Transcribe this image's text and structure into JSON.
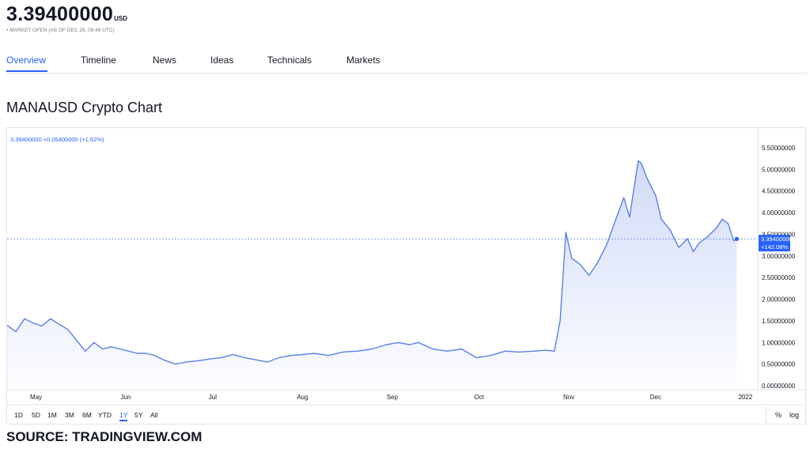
{
  "header": {
    "price": "3.39400000",
    "currency": "USD",
    "status_dot": "•",
    "status_text": "MARKET OPEN",
    "status_time": "(AS OF DEC 29, 09:48 UTC)"
  },
  "tabs": [
    "Overview",
    "Timeline",
    "News",
    "Ideas",
    "Technicals",
    "Markets"
  ],
  "active_tab": "Overview",
  "chart_title": "MANAUSD Crypto Chart",
  "chart_legend": "3.39400000 +0.05400000 (+1.62%)",
  "last_price_label": "3.39400000",
  "last_change_label": "+142.08%",
  "ranges": [
    "1D",
    "5D",
    "1M",
    "3M",
    "6M",
    "YTD",
    "1Y",
    "5Y",
    "All"
  ],
  "active_range": "1Y",
  "options": {
    "percent": "%",
    "log": "log"
  },
  "source": "SOURCE: TRADINGVIEW.COM",
  "colors": {
    "accent": "#2962ff",
    "line": "#5b7fe8",
    "status_green": "#26a69a"
  },
  "chart_data": {
    "type": "area",
    "title": "MANAUSD Crypto Chart",
    "xlabel": "",
    "ylabel": "",
    "ylim": [
      0,
      5.5
    ],
    "xlim": [
      "2021-04-21",
      "2022-01-05"
    ],
    "grid": false,
    "y_ticks": [
      "0.00000000",
      "0.50000000",
      "1.00000000",
      "1.50000000",
      "2.00000000",
      "2.50000000",
      "3.00000000",
      "3.50000000",
      "4.00000000",
      "4.50000000",
      "5.00000000",
      "5.50000000"
    ],
    "y_tick_values": [
      0,
      0.5,
      1,
      1.5,
      2,
      2.5,
      3,
      3.5,
      4,
      4.5,
      5,
      5.5
    ],
    "x_ticks": [
      {
        "label": "May",
        "date": "2021-05-01"
      },
      {
        "label": "Jun",
        "date": "2021-06-01"
      },
      {
        "label": "Jul",
        "date": "2021-07-01"
      },
      {
        "label": "Aug",
        "date": "2021-08-01"
      },
      {
        "label": "Sep",
        "date": "2021-09-01"
      },
      {
        "label": "Oct",
        "date": "2021-10-01"
      },
      {
        "label": "Nov",
        "date": "2021-11-01"
      },
      {
        "label": "Dec",
        "date": "2021-12-01"
      },
      {
        "label": "2022",
        "date": "2022-01-01"
      }
    ],
    "last_value": 3.394,
    "series": [
      {
        "x": [
          "2021-04-21",
          "2021-04-24",
          "2021-04-27",
          "2021-04-30",
          "2021-05-03",
          "2021-05-06",
          "2021-05-09",
          "2021-05-12",
          "2021-05-15",
          "2021-05-18",
          "2021-05-21",
          "2021-05-24",
          "2021-05-27",
          "2021-05-30",
          "2021-06-02",
          "2021-06-05",
          "2021-06-08",
          "2021-06-11",
          "2021-06-14",
          "2021-06-18",
          "2021-06-22",
          "2021-06-26",
          "2021-06-30",
          "2021-07-04",
          "2021-07-08",
          "2021-07-12",
          "2021-07-16",
          "2021-07-20",
          "2021-07-24",
          "2021-07-28",
          "2021-08-01",
          "2021-08-05",
          "2021-08-10",
          "2021-08-15",
          "2021-08-20",
          "2021-08-25",
          "2021-08-30",
          "2021-09-03",
          "2021-09-07",
          "2021-09-10",
          "2021-09-15",
          "2021-09-20",
          "2021-09-25",
          "2021-09-30",
          "2021-10-05",
          "2021-10-10",
          "2021-10-15",
          "2021-10-20",
          "2021-10-24",
          "2021-10-27",
          "2021-10-29",
          "2021-10-31",
          "2021-11-02",
          "2021-11-05",
          "2021-11-08",
          "2021-11-11",
          "2021-11-14",
          "2021-11-17",
          "2021-11-20",
          "2021-11-22",
          "2021-11-25",
          "2021-11-26",
          "2021-11-28",
          "2021-12-01",
          "2021-12-03",
          "2021-12-06",
          "2021-12-09",
          "2021-12-12",
          "2021-12-14",
          "2021-12-16",
          "2021-12-19",
          "2021-12-22",
          "2021-12-24",
          "2021-12-26",
          "2021-12-28",
          "2021-12-29"
        ],
        "y": [
          1.4,
          1.25,
          1.55,
          1.45,
          1.38,
          1.55,
          1.42,
          1.3,
          1.05,
          0.8,
          1.0,
          0.85,
          0.9,
          0.85,
          0.8,
          0.75,
          0.75,
          0.7,
          0.6,
          0.5,
          0.55,
          0.58,
          0.62,
          0.65,
          0.72,
          0.65,
          0.6,
          0.55,
          0.65,
          0.7,
          0.72,
          0.75,
          0.7,
          0.78,
          0.8,
          0.85,
          0.95,
          1.0,
          0.95,
          1.0,
          0.85,
          0.8,
          0.85,
          0.65,
          0.7,
          0.8,
          0.78,
          0.8,
          0.82,
          0.8,
          1.5,
          3.55,
          2.95,
          2.8,
          2.55,
          2.85,
          3.25,
          3.8,
          4.35,
          3.9,
          5.2,
          5.15,
          4.8,
          4.4,
          3.85,
          3.6,
          3.2,
          3.4,
          3.1,
          3.3,
          3.45,
          3.65,
          3.85,
          3.75,
          3.35,
          3.394
        ]
      }
    ]
  }
}
